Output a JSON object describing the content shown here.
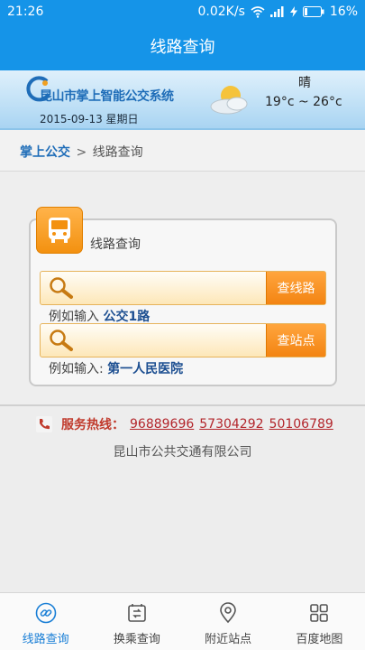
{
  "status_bar": {
    "time": "21:26",
    "speed": "0.02K/s",
    "battery": "16%"
  },
  "header": {
    "title": "线路查询"
  },
  "banner": {
    "brand": "昆山市掌上智能公交系统",
    "date": "2015-09-13 星期日",
    "weather_condition": "晴",
    "weather_temp": "19°c ~ 26°c"
  },
  "breadcrumb": {
    "home": "掌上公交",
    "separator": ">",
    "current": "线路查询"
  },
  "card": {
    "title": "线路查询",
    "route_search": {
      "button": "查线路",
      "value": "",
      "hint_prefix": "例如输入",
      "hint_example": "公交1路"
    },
    "stop_search": {
      "button": "查站点",
      "value": "",
      "hint_prefix": "例如输入:",
      "hint_example": "第一人民医院"
    }
  },
  "hotline": {
    "label": "服务热线：",
    "numbers": [
      "96889696",
      "57304292",
      "50106789"
    ]
  },
  "company": "昆山市公共交通有限公司",
  "bottom_nav": {
    "items": [
      {
        "label": "线路查询",
        "icon": "link-icon",
        "active": true
      },
      {
        "label": "换乘查询",
        "icon": "transfer-icon",
        "active": false
      },
      {
        "label": "附近站点",
        "icon": "location-pin-icon",
        "active": false
      },
      {
        "label": "百度地图",
        "icon": "grid-icon",
        "active": false
      }
    ]
  },
  "colors": {
    "primary": "#1594e8",
    "accent_orange": "#f39110",
    "hotline_red": "#b3262c",
    "active_nav": "#1a7fd6"
  }
}
